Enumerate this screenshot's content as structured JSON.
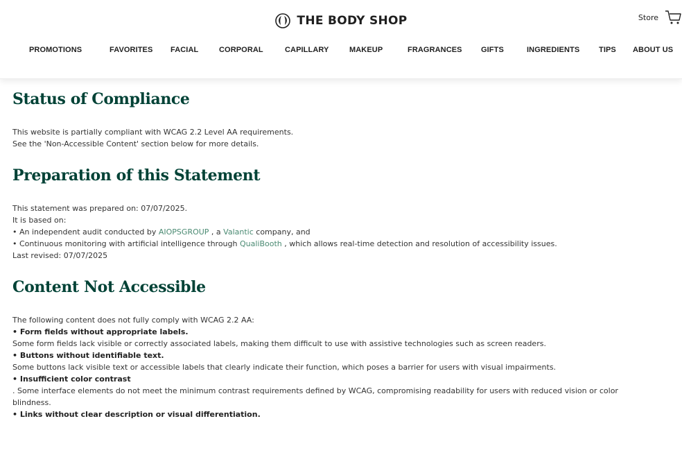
{
  "header": {
    "logo_text": "THE BODY SHOP",
    "store_label": "Store",
    "nav": [
      "PROMOTIONS",
      "FAVORITES",
      "FACIAL",
      "CORPORAL",
      "CAPILLARY",
      "MAKEUP",
      "FRAGRANCES",
      "GIFTS",
      "INGREDIENTS",
      "TIPS",
      "ABOUT US"
    ]
  },
  "compliance": {
    "heading": "Status of Compliance",
    "line1": "This website is partially compliant with WCAG 2.2 Level AA requirements.",
    "line2": "See the 'Non-Accessible Content' section below for more details."
  },
  "preparation": {
    "heading": "Preparation of this Statement",
    "prepared": "This statement was prepared on: 07/07/2025.",
    "based": "It is based on:",
    "audit_pre": "• An independent audit conducted by ",
    "audit_link1": "AIOPSGROUP",
    "audit_mid": " , a ",
    "audit_link2": "Valantic",
    "audit_post": " company, and",
    "monitor_pre": "• Continuous monitoring with artificial intelligence through ",
    "monitor_link": "QualiBooth",
    "monitor_post": " , which allows real-time detection and resolution of accessibility issues.",
    "revised": "Last revised: 07/07/2025"
  },
  "not_accessible": {
    "heading": "Content Not Accessible",
    "intro": "The following content does not fully comply with WCAG 2.2 AA:",
    "item1_title": "• Form fields without appropriate labels.",
    "item1_text": "Some form fields lack visible or correctly associated labels, making them difficult to use with assistive technologies such as screen readers.",
    "item2_title": "• Buttons without identifiable text.",
    "item2_text": "Some buttons lack visible text or accessible labels that clearly indicate their function, which poses a barrier for users with visual impairments.",
    "item3_title": "• Insufficient color contrast",
    "item3_text_a": ". Some interface elements do not meet the minimum contrast requirements defined by WCAG, compromising readability for users with reduced vision or color",
    "item3_text_b": "blindness.",
    "item4_title": "• Links without clear description or visual differentiation."
  },
  "colors": {
    "heading": "#004236",
    "link": "#4a8a72",
    "text": "#333333"
  },
  "icons": [
    "body-shop-logo-icon",
    "cart-icon"
  ]
}
